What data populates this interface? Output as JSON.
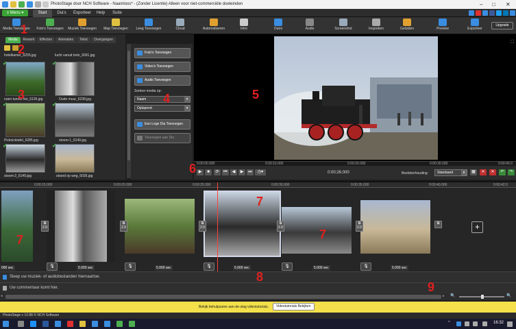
{
  "window": {
    "title": "PhotoStage door NCH Software - Naamloos* - (Zonder Licentie) Alleen voor niet-commerciële doeleinden"
  },
  "menu": {
    "menu_button": "≡ Menu ▾",
    "tabs": [
      "Start",
      "Dia's",
      "Exporteer",
      "Help",
      "Suite"
    ]
  },
  "toolbar": {
    "items": [
      {
        "label": "Media Toevoegen",
        "color": "#3a8de0"
      },
      {
        "label": "Foto's Toevoegen",
        "color": "#4caf50"
      },
      {
        "label": "Muziek Toevoegen",
        "color": "#e0a030"
      },
      {
        "label": "Map Toevoegen",
        "color": "#e0c040"
      },
      {
        "label": "Leeg Toevoegen",
        "color": "#3a8de0"
      },
      {
        "label": "Cloud",
        "color": "#9ab"
      },
      {
        "label": "Automatiseren",
        "color": "#e0a030"
      },
      {
        "label": "Intro",
        "color": "#ccc"
      },
      {
        "label": "Outro",
        "color": "#3a8de0"
      },
      {
        "label": "Audio",
        "color": "#888"
      },
      {
        "label": "Screenshot",
        "color": "#9ab"
      },
      {
        "label": "Inspreken",
        "color": "#aaa"
      },
      {
        "label": "Geluiden",
        "color": "#e0a030"
      },
      {
        "label": "Preview",
        "color": "#3a8de0"
      },
      {
        "label": "Exporteer",
        "color": "#3a8de0"
      }
    ],
    "upgrade": "Upgrade"
  },
  "media_panel": {
    "tabs": [
      "Media",
      "Rework",
      "Effecten",
      "Animaties",
      "Tekst",
      "Overgangen"
    ],
    "top_labels": [
      "hotelkamer_6255.jpg",
      "lucht vanuit trein_6091.jpg"
    ],
    "thumbnails": [
      {
        "name": "ruien tunnel riet_6136.jpg"
      },
      {
        "name": "Oude muur_6238.jpg"
      },
      {
        "name": "Picknicktafel_6285.jpg"
      },
      {
        "name": "stoom-1_6149.jpg"
      },
      {
        "name": "stoom-2_6149.jpg"
      },
      {
        "name": "strand op weg_6039.jpg"
      }
    ]
  },
  "side_panel": {
    "add_photos": "Foto's Toevoegen",
    "add_videos": "Video's Toevoegen",
    "add_audio": "Audio Toevoegen",
    "sort_label": "Sorteer media op:",
    "sort_by": "Naam",
    "sort_order": "Oplopend",
    "add_empty": "Een Lege Dia Toevoegen",
    "add_to_slide": "Toevoegen aan Dia"
  },
  "preview": {
    "ruler": [
      "0:00:00.000",
      "0:00:10.000",
      "0:00:20.000",
      "0:00:30.000",
      "0:00:40.0"
    ],
    "time": "0:00:26.000",
    "aspect_label": "Beeldverhouding:",
    "aspect_value": "Standaard"
  },
  "timeline": {
    "ruler": [
      "0:00:15.000",
      "0:00:20.000",
      "0:00:25.000",
      "0:00:30.000",
      "0:00:35.000",
      "0:00:40.000",
      "0:00:42.0"
    ],
    "transition_value": "2.0",
    "clip_durations": [
      "000 sec",
      "5.000 sec",
      "5.000 sec",
      "5.000 sec",
      "5.000 sec",
      "5.000 sec"
    ],
    "music_track": "Sleep uw muziek- of audiobestanden hiernaartoe.",
    "voice_track": "Uw commentaar komt hier."
  },
  "infobar": {
    "message": "Bekijk behulpzame aan-de-slag videotutorials.",
    "button": "Videotutorials Bekijken"
  },
  "status": {
    "version": "PhotoStage v 10.88 © NCH Software"
  },
  "taskbar": {
    "clock": "16:32"
  },
  "annotations": [
    "1",
    "2",
    "3",
    "4",
    "5",
    "6",
    "7",
    "7",
    "7",
    "8",
    "9"
  ]
}
